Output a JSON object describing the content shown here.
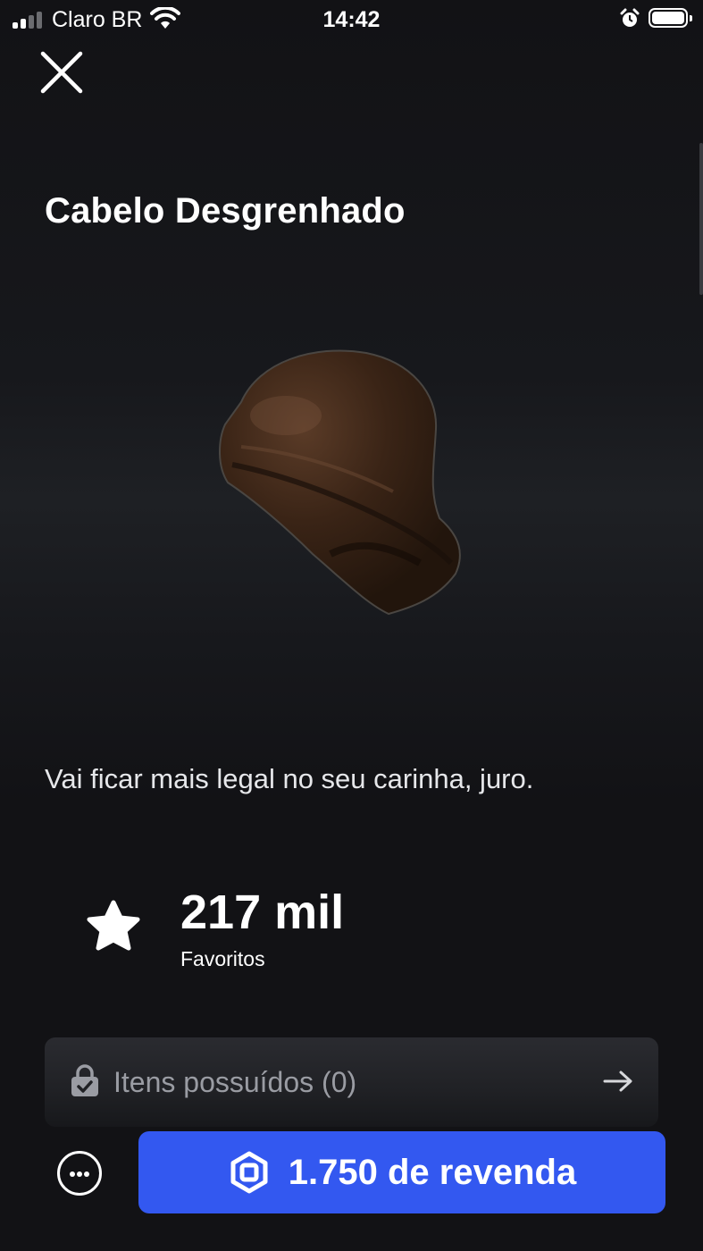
{
  "status_bar": {
    "carrier": "Claro BR",
    "time": "14:42",
    "signal_bars": 4,
    "signal_active_bars": 2
  },
  "header": {
    "close_icon": "close-icon"
  },
  "item": {
    "title": "Cabelo Desgrenhado",
    "image": "brown-messy-hair-accessory",
    "description": "Vai ficar mais legal no seu carinha, juro."
  },
  "favorites": {
    "icon": "star-icon",
    "count": "217 mil",
    "label": "Favoritos"
  },
  "owned": {
    "icon": "lock-icon",
    "label": "Itens possuídos (0)",
    "arrow_icon": "arrow-right-icon"
  },
  "actions": {
    "more_icon": "more-icon",
    "buy_icon": "robux-icon",
    "buy_label": "1.750 de revenda",
    "buy_color": "#3358f0"
  },
  "colors": {
    "background": "#121215",
    "text": "#ffffff",
    "muted_text": "#9a9ca3"
  }
}
